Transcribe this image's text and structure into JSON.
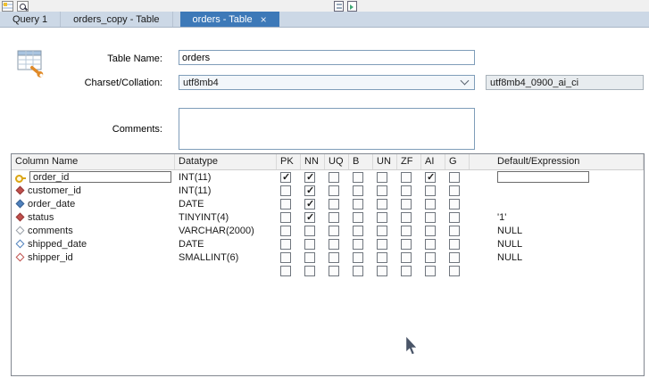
{
  "toolbar": {
    "left_icons": [
      {
        "cls": "apply-icon",
        "name": "table-grid-icon"
      },
      {
        "cls": "find-icon",
        "name": "search-icon"
      }
    ],
    "right_icons": [
      {
        "cls": "export-icon",
        "name": "export-icon"
      },
      {
        "cls": "import-icon",
        "name": "import-icon"
      }
    ]
  },
  "tabs": [
    {
      "label": "Query 1",
      "active": false,
      "closable": false
    },
    {
      "label": "orders_copy - Table",
      "active": false,
      "closable": false
    },
    {
      "label": "orders - Table",
      "active": true,
      "closable": true,
      "close_glyph": "×"
    }
  ],
  "form": {
    "table_name_label": "Table Name:",
    "table_name_value": "orders",
    "charset_label": "Charset/Collation:",
    "charset_value": "utf8mb4",
    "collation_value": "utf8mb4_0900_ai_ci",
    "comments_label": "Comments:",
    "comments_value": ""
  },
  "grid": {
    "headers": [
      "Column Name",
      "Datatype",
      "PK",
      "NN",
      "UQ",
      "B",
      "UN",
      "ZF",
      "AI",
      "G",
      "Default/Expression"
    ],
    "flag_keys": [
      "pk",
      "nn",
      "uq",
      "b",
      "un",
      "zf",
      "ai",
      "g"
    ],
    "rows": [
      {
        "name": "order_id",
        "datatype": "INT(11)",
        "icon_cls": "icon-key",
        "icon_name": "primary-key-icon",
        "checks": [
          true,
          true,
          false,
          false,
          false,
          false,
          true,
          false
        ],
        "default": "",
        "editing": true
      },
      {
        "name": "customer_id",
        "datatype": "INT(11)",
        "icon_cls": "diamond d-red-filled",
        "icon_name": "red-diamond-column-icon",
        "checks": [
          false,
          true,
          false,
          false,
          false,
          false,
          false,
          false
        ],
        "default": ""
      },
      {
        "name": "order_date",
        "datatype": "DATE",
        "icon_cls": "diamond d-blue-filled",
        "icon_name": "blue-diamond-column-icon",
        "checks": [
          false,
          true,
          false,
          false,
          false,
          false,
          false,
          false
        ],
        "default": ""
      },
      {
        "name": "status",
        "datatype": "TINYINT(4)",
        "icon_cls": "diamond d-red-filled",
        "icon_name": "red-diamond-column-icon",
        "checks": [
          false,
          true,
          false,
          false,
          false,
          false,
          false,
          false
        ],
        "default": "'1'"
      },
      {
        "name": "comments",
        "datatype": "VARCHAR(2000)",
        "icon_cls": "diamond d-gray-outline",
        "icon_name": "gray-diamond-column-icon",
        "checks": [
          false,
          false,
          false,
          false,
          false,
          false,
          false,
          false
        ],
        "default": "NULL"
      },
      {
        "name": "shipped_date",
        "datatype": "DATE",
        "icon_cls": "diamond d-blue-outline",
        "icon_name": "blue-outline-diamond-column-icon",
        "checks": [
          false,
          false,
          false,
          false,
          false,
          false,
          false,
          false
        ],
        "default": "NULL"
      },
      {
        "name": "shipper_id",
        "datatype": "SMALLINT(6)",
        "icon_cls": "diamond d-red-outline",
        "icon_name": "red-outline-diamond-column-icon",
        "checks": [
          false,
          false,
          false,
          false,
          false,
          false,
          false,
          false
        ],
        "default": "NULL"
      },
      {
        "name": "",
        "datatype": "",
        "icon_cls": "",
        "icon_name": "",
        "checks": [
          false,
          false,
          false,
          false,
          false,
          false,
          false,
          false
        ],
        "default": "",
        "empty": true
      }
    ]
  }
}
